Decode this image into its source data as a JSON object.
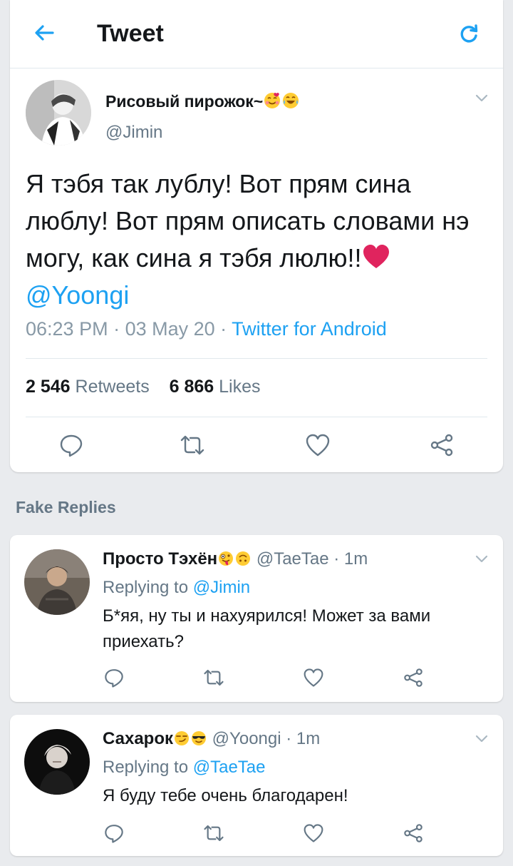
{
  "header": {
    "title": "Tweet"
  },
  "tweet": {
    "author_name": "Рисовый пирожок~",
    "handle": "@Jimin",
    "text": "Я тэбя так лублу! Вот прям сина люблу! Вот прям описать словами нэ могу, как сина я тэбя люлю!!",
    "mention": "@Yoongi",
    "time": "06:23 PM",
    "date": "03 May 20",
    "source": "Twitter for Android",
    "retweets_count": "2 546",
    "retweets_label": "Retweets",
    "likes_count": "6 866",
    "likes_label": "Likes"
  },
  "section_label": "Fake Replies",
  "replies": [
    {
      "name": "Просто Тэхён",
      "handle": "@TaeTae",
      "time": "1m",
      "replying_label": "Replying to",
      "replying_to": "@Jimin",
      "text": "Б*яя, ну ты и нахуярился! Может за вами приехать?"
    },
    {
      "name": "Сахарок",
      "handle": "@Yoongi",
      "time": "1m",
      "replying_label": "Replying to",
      "replying_to": "@TaeTae",
      "text": "Я буду тебе очень благодарен!"
    }
  ],
  "colors": {
    "accent": "#1da1f2",
    "heart": "#e0245e",
    "muted": "#657786",
    "background": "#e9ebee"
  },
  "icons": [
    "back-arrow-icon",
    "refresh-icon",
    "chevron-down-icon",
    "reply-icon",
    "retweet-icon",
    "like-icon",
    "share-icon"
  ]
}
